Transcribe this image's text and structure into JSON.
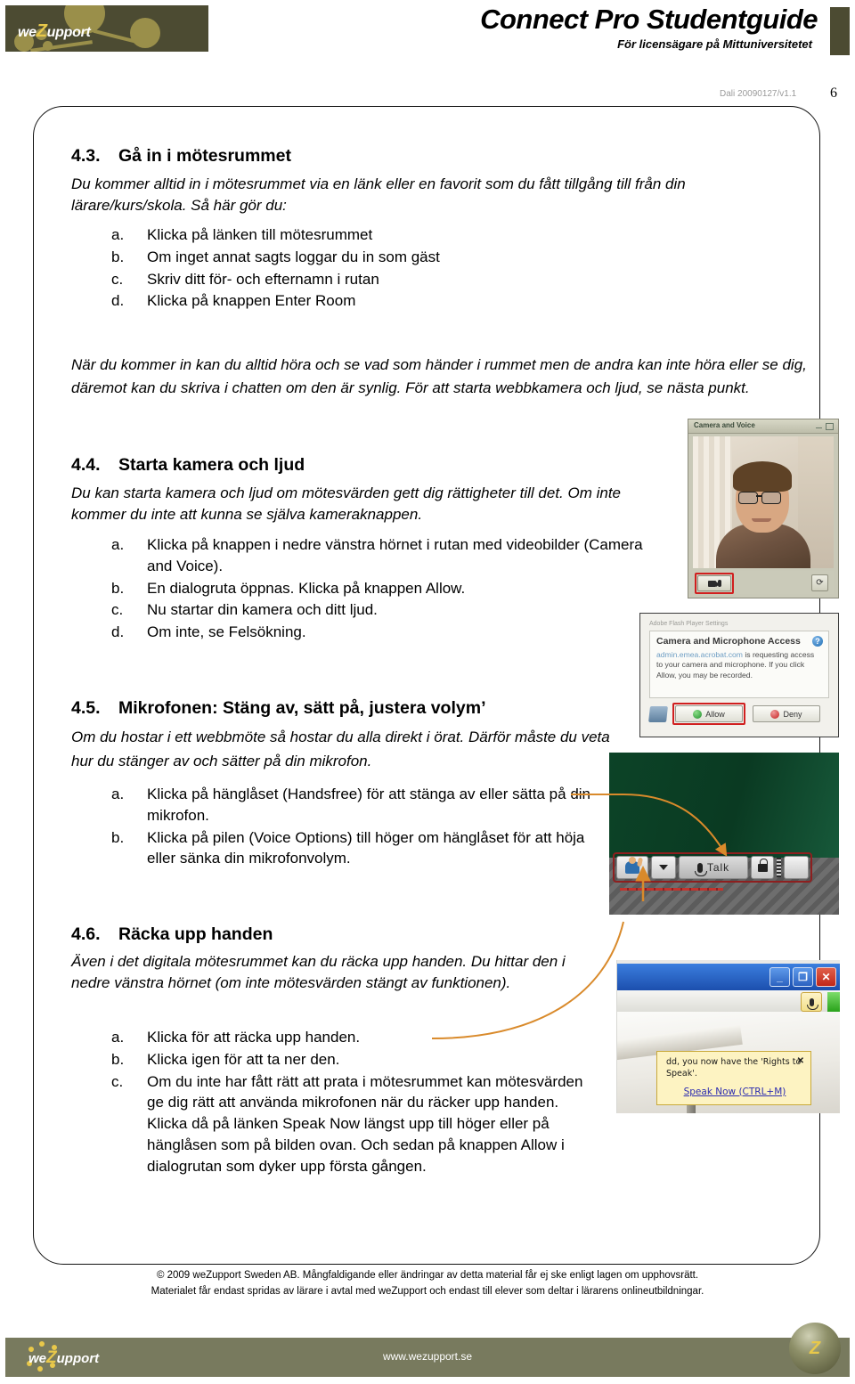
{
  "header": {
    "logo_text_pre": "we",
    "logo_text_z": "Z",
    "logo_text_post": "upport",
    "title": "Connect Pro Studentguide",
    "subtitle": "För licensägare på Mittuniversitetet"
  },
  "meta": {
    "doc_version": "Dali 20090127/v1.1",
    "page_number": "6"
  },
  "sections": {
    "s43": {
      "number": "4.3.",
      "heading": "Gå in i mötesrummet",
      "intro": "Du kommer alltid in i mötesrummet via en länk eller en favorit som du fått tillgång till från din lärare/kurs/skola. Så här gör du:",
      "items": [
        {
          "marker": "a.",
          "text": "Klicka på länken till mötesrummet"
        },
        {
          "marker": "b.",
          "text": "Om inget annat sagts loggar du in som gäst"
        },
        {
          "marker": "c.",
          "text": "Skriv ditt för- och efternamn i rutan"
        },
        {
          "marker": "d.",
          "text": "Klicka på knappen Enter Room"
        }
      ],
      "outro": "När du kommer in kan du alltid höra och se vad som händer i rummet men de andra kan inte höra eller se dig, däremot kan du skriva i chatten om den är synlig. För att starta webbkamera och ljud, se nästa punkt."
    },
    "s44": {
      "number": "4.4.",
      "heading": "Starta kamera och ljud",
      "intro": "Du kan starta kamera och ljud om mötesvärden gett dig rättigheter till det. Om inte kommer du inte att kunna se själva kameraknappen.",
      "items": [
        {
          "marker": "a.",
          "text": "Klicka på knappen i nedre vänstra hörnet i rutan med videobilder (Camera and Voice)."
        },
        {
          "marker": "b.",
          "text": "En dialogruta öppnas. Klicka på knappen Allow."
        },
        {
          "marker": "c.",
          "text": "Nu startar din kamera och ditt ljud."
        },
        {
          "marker": "d.",
          "text": "Om inte, se Felsökning."
        }
      ]
    },
    "s45": {
      "number": "4.5.",
      "heading": "Mikrofonen: Stäng av, sätt på, justera volym’",
      "intro": "Om du hostar i ett webbmöte så hostar du alla direkt i örat. Därför måste du veta hur du stänger av och sätter på din mikrofon.",
      "items": [
        {
          "marker": "a.",
          "text": "Klicka på hänglåset (Handsfree) för att stänga av eller sätta på din mikrofon."
        },
        {
          "marker": "b.",
          "text": "Klicka på pilen (Voice Options) till höger om hänglåset för att höja eller sänka din mikrofonvolym."
        }
      ]
    },
    "s46": {
      "number": "4.6.",
      "heading": "Räcka upp handen",
      "intro": "Även i det digitala mötesrummet kan du räcka upp handen. Du hittar den i nedre vänstra hörnet (om inte mötesvärden stängt av funktionen).",
      "items": [
        {
          "marker": "a.",
          "text": "Klicka för att räcka upp handen."
        },
        {
          "marker": "b.",
          "text": "Klicka igen för att ta ner den."
        },
        {
          "marker": "c.",
          "text": "Om du inte har fått rätt att prata i mötesrummet kan mötesvärden ge dig rätt att använda mikrofonen när du räcker upp handen. Klicka då på länken Speak Now längst upp till höger eller på hänglåsen som på bilden ovan. Och sedan på knappen Allow i dialogrutan som dyker upp första gången."
        }
      ]
    }
  },
  "figures": {
    "camera_pod": {
      "title": "Camera and Voice"
    },
    "flash_dialog": {
      "caption": "Adobe Flash Player Settings",
      "heading": "Camera and Microphone Access",
      "body_link": "admin.emea.acrobat.com",
      "body_text": " is requesting access to your camera and microphone. If you click Allow, you may be recorded.",
      "allow_label": "Allow",
      "deny_label": "Deny",
      "help_glyph": "?"
    },
    "toolbar": {
      "talk_label": "Talk"
    },
    "speak_now": {
      "min_glyph": "_",
      "restore_glyph": "❐",
      "close_glyph": "✕",
      "tooltip_text": "dd, you now have the 'Rights to Speak'.",
      "tooltip_close": "✕",
      "link_label": "Speak Now (CTRL+M)"
    }
  },
  "footer": {
    "legal_line1": "© 2009 weZupport Sweden AB. Mångfaldigande eller ändringar av detta material får ej ske enligt lagen om upphovsrätt.",
    "legal_line2": "Materialet får endast spridas av lärare i avtal med weZupport och endast till elever som deltar i lärarens onlineutbildningar.",
    "url": "www.wezupport.se",
    "logo_pre": "we",
    "logo_z": "Z",
    "logo_post": "upport",
    "badge_glyph": "Z"
  },
  "colors": {
    "brand_dark": "#4c4b32",
    "brand_olive": "#787a5e",
    "brand_gold": "#e8c84a",
    "annotation_orange": "#d98a2b",
    "highlight_red": "#d01f1f"
  }
}
